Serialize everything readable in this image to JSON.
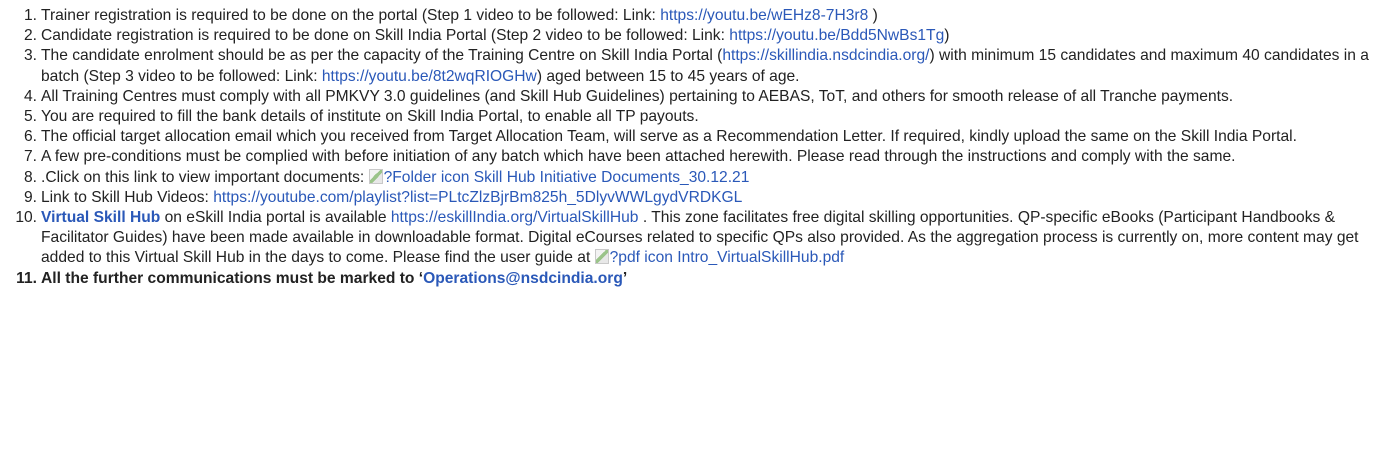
{
  "items": [
    {
      "num": "1.",
      "text": "Trainer registration is required to be done on the portal (Step 1 video to be followed: Link: ",
      "link": "https://youtu.be/wEHz8-7H3r8",
      "tail": " )"
    },
    {
      "num": "2.",
      "text": "Candidate registration is required to be done on Skill India Portal (Step 2 video to be followed: Link: ",
      "link": "https://youtu.be/Bdd5NwBs1Tg",
      "tail": ")"
    },
    {
      "num": "3.",
      "text": "The candidate enrolment should be as per the capacity of the Training Centre on Skill India Portal (",
      "link": "https://skillindia.nsdcindia.org/",
      "mid": ") with minimum 15 candidates and maximum 40 candidates in a batch (Step 3 video to be followed: Link: ",
      "link2": "https://youtu.be/8t2wqRIOGHw",
      "tail": ") aged between 15 to 45 years of age."
    },
    {
      "num": "4.",
      "text": "All Training Centres must comply with all PMKVY 3.0 guidelines (and Skill Hub Guidelines) pertaining to AEBAS, ToT, and others for smooth release of all Tranche payments."
    },
    {
      "num": "5.",
      "text": "You are required to fill the bank details of institute on Skill India Portal, to enable all TP payouts."
    },
    {
      "num": "6.",
      "text": "The official target allocation email which you received from Target Allocation Team, will serve as a Recommendation Letter. If required, kindly upload the same on the Skill India Portal."
    },
    {
      "num": "7.",
      "text": "A few pre-conditions must be complied with before initiation of any batch which have been attached herewith. Please read through the instructions and comply with the same."
    },
    {
      "num": "8.",
      "text": ".Click on this link to view important documents: ",
      "img_alt": "?Folder icon",
      "link": "Skill Hub Initiative Documents_30.12.21"
    },
    {
      "num": "9.",
      "text": "Link to Skill Hub Videos: ",
      "link": "https://youtube.com/playlist?list=PLtcZlzBjrBm825h_5DlyvWWLgydVRDKGL"
    },
    {
      "num": "10.",
      "bold_link": "Virtual Skill Hub",
      "text": " on eSkill India portal is available ",
      "link": "https://eskillIndia.org/VirtualSkillHub",
      "mid": " . This zone facilitates free digital skilling opportunities. QP-specific eBooks (Participant Handbooks & Facilitator Guides) have been made available in downloadable format. Digital eCourses related to specific QPs also provided. As the aggregation process is currently on, more content may get added to this Virtual Skill Hub in the days to come. Please find the user guide at ",
      "img_alt": "?pdf icon",
      "link2": "Intro_VirtualSkillHub.pdf"
    },
    {
      "num": "11.",
      "text": "All the further communications must be marked to ‘",
      "link": "Operations@nsdcindia.org",
      "tail": "’"
    }
  ],
  "colors": {
    "link": "#2a58b8",
    "text": "#222222"
  }
}
